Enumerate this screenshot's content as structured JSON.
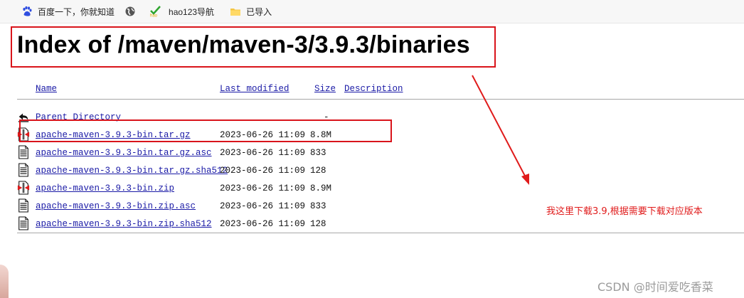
{
  "bookmarks": {
    "items": [
      {
        "label": "百度一下，你就知道",
        "icon": "baidu-paw-icon"
      },
      {
        "label": "",
        "icon": "globe-icon"
      },
      {
        "label": "hao123导航",
        "icon": "hao123-icon"
      },
      {
        "label": "已导入",
        "icon": "folder-icon"
      }
    ]
  },
  "page": {
    "title": "Index of /maven/maven-3/3.9.3/binaries",
    "columns": {
      "name": "Name",
      "last_modified": "Last modified",
      "size": "Size",
      "description": "Description"
    },
    "rows": [
      {
        "name": "Parent Directory",
        "date": "",
        "size": "-",
        "icon": "back-arrow-icon"
      },
      {
        "name": "apache-maven-3.9.3-bin.tar.gz",
        "date": "2023-06-26 11:09",
        "size": "8.8M",
        "icon": "archive-file-icon"
      },
      {
        "name": "apache-maven-3.9.3-bin.tar.gz.asc",
        "date": "2023-06-26 11:09",
        "size": "833",
        "icon": "text-file-icon"
      },
      {
        "name": "apache-maven-3.9.3-bin.tar.gz.sha512",
        "date": "2023-06-26 11:09",
        "size": "128",
        "icon": "text-file-icon"
      },
      {
        "name": "apache-maven-3.9.3-bin.zip",
        "date": "2023-06-26 11:09",
        "size": "8.9M",
        "icon": "archive-file-icon"
      },
      {
        "name": "apache-maven-3.9.3-bin.zip.asc",
        "date": "2023-06-26 11:09",
        "size": "833",
        "icon": "text-file-icon"
      },
      {
        "name": "apache-maven-3.9.3-bin.zip.sha512",
        "date": "2023-06-26 11:09",
        "size": "128",
        "icon": "text-file-icon"
      }
    ]
  },
  "annotation": {
    "text": "我这里下载3.9,根据需要下载对应版本",
    "color": "#e01b1b"
  },
  "watermark": "CSDN @时间爱吃香菜",
  "colors": {
    "link": "#1a1aa6",
    "highlight_box": "#d9141b"
  }
}
